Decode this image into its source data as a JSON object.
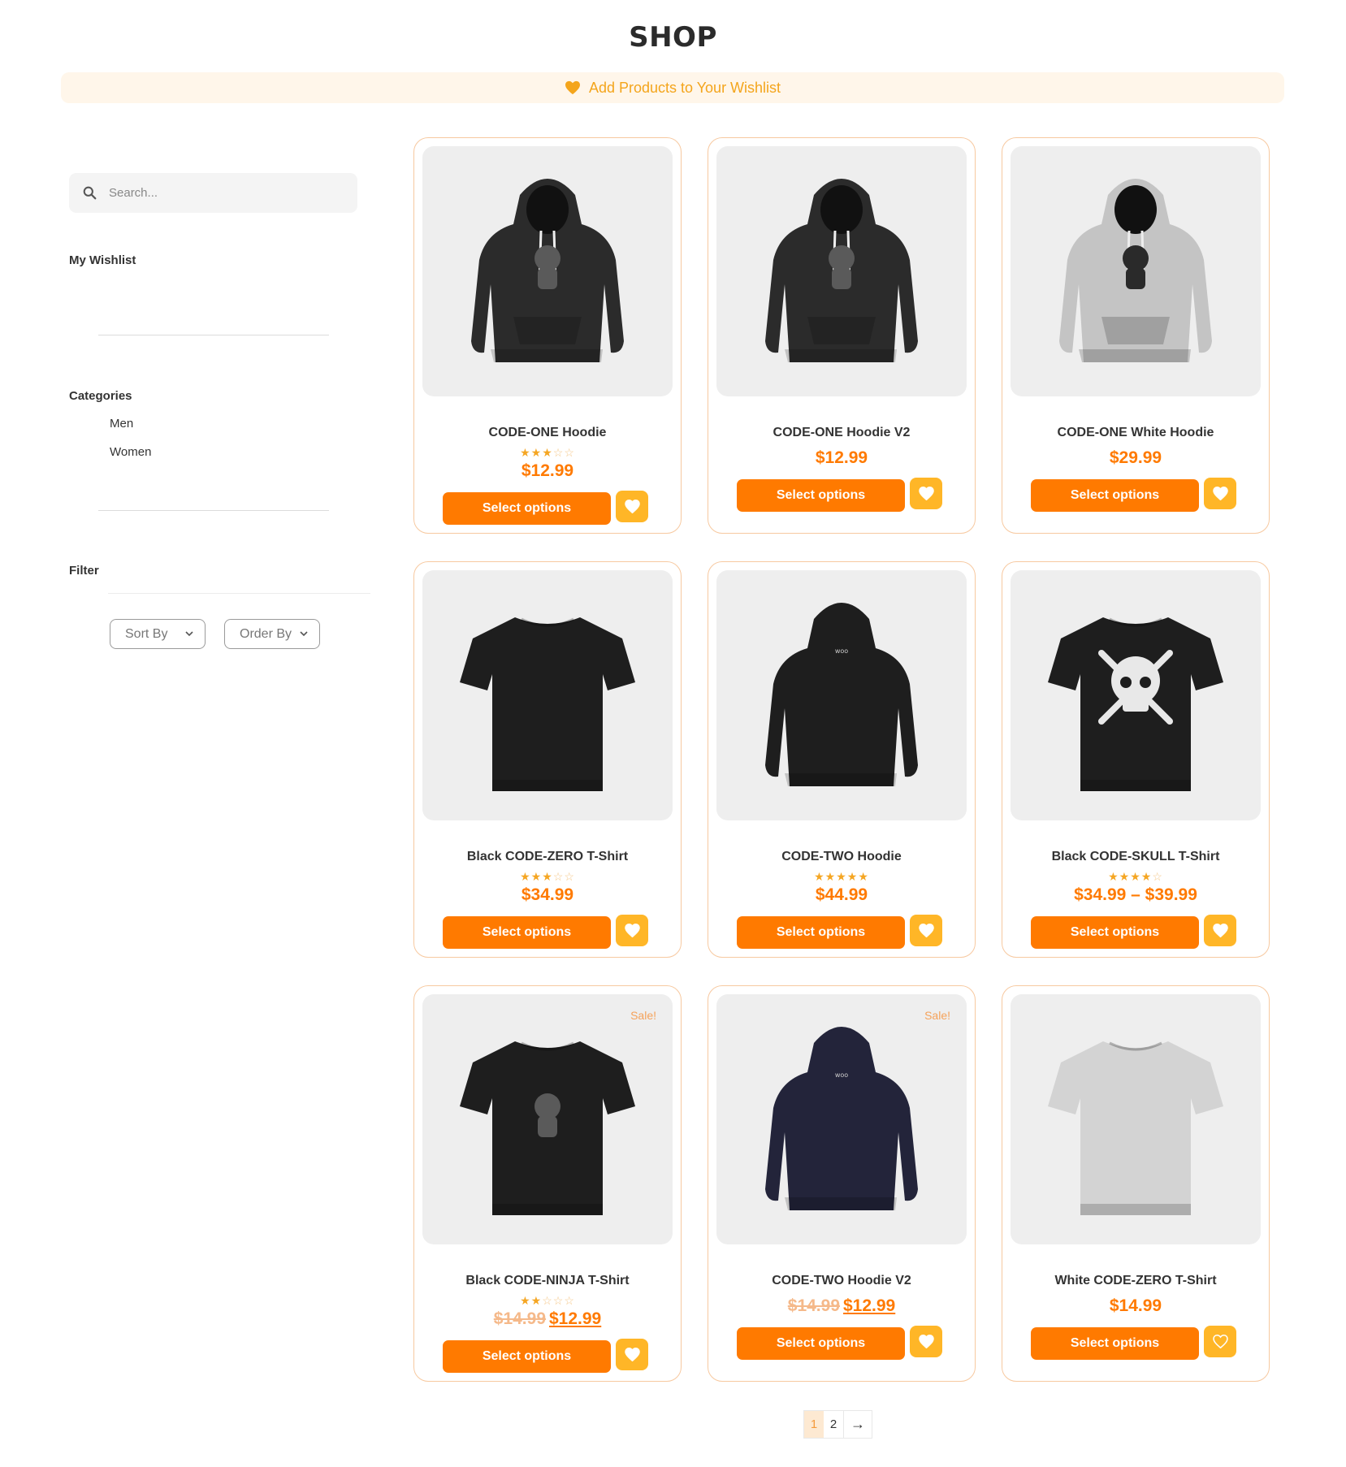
{
  "page": {
    "title": "SHOP"
  },
  "banner": {
    "text": "Add Products to Your Wishlist",
    "color": "#f4a51c"
  },
  "sidebar": {
    "search_placeholder": "Search...",
    "wishlist_heading": "My Wishlist",
    "categories_heading": "Categories",
    "categories": [
      "Men",
      "Women"
    ],
    "filter_heading": "Filter",
    "sort_by": "Sort By",
    "order_by": "Order By"
  },
  "products": [
    {
      "name": "CODE-ONE Hoodie",
      "rating": 3,
      "price": "$12.99",
      "old_price": "",
      "sale": false,
      "item": "hoodie",
      "color": "#2b2b2b",
      "graphic": "figure"
    },
    {
      "name": "CODE-ONE Hoodie V2",
      "rating": 0,
      "price": "$12.99",
      "old_price": "",
      "sale": false,
      "item": "hoodie",
      "color": "#2b2b2b",
      "graphic": "figure"
    },
    {
      "name": "CODE-ONE White Hoodie",
      "rating": 0,
      "price": "$29.99",
      "old_price": "",
      "sale": false,
      "item": "hoodie",
      "color": "#c4c4c4",
      "graphic": "figure"
    },
    {
      "name": "Black CODE-ZERO T-Shirt",
      "rating": 3,
      "price": "$34.99",
      "old_price": "",
      "sale": false,
      "item": "tshirt",
      "color": "#1e1e1e",
      "graphic": "none"
    },
    {
      "name": "CODE-TWO Hoodie",
      "rating": 5,
      "price": "$44.99",
      "old_price": "",
      "sale": false,
      "item": "hoodie-back",
      "color": "#1e1e1e",
      "graphic": "none"
    },
    {
      "name": "Black CODE-SKULL T-Shirt",
      "rating": 4,
      "price": "$34.99 – $39.99",
      "old_price": "",
      "sale": false,
      "item": "tshirt",
      "color": "#1e1e1e",
      "graphic": "skull"
    },
    {
      "name": "Black CODE-NINJA T-Shirt",
      "rating": 2,
      "price": "$12.99",
      "old_price": "$14.99",
      "sale": true,
      "item": "tshirt",
      "color": "#1e1e1e",
      "graphic": "figure"
    },
    {
      "name": "CODE-TWO Hoodie V2",
      "rating": 0,
      "price": "$12.99",
      "old_price": "$14.99",
      "sale": true,
      "item": "hoodie-back",
      "color": "#23243a",
      "graphic": "none"
    },
    {
      "name": "White CODE-ZERO T-Shirt",
      "rating": 0,
      "price": "$14.99",
      "old_price": "",
      "sale": false,
      "item": "tshirt",
      "color": "#d3d3d3",
      "graphic": "none"
    }
  ],
  "labels": {
    "select_options": "Select options",
    "sale": "Sale!"
  },
  "pagination": {
    "current": "1",
    "pages": [
      "1",
      "2"
    ],
    "next": "→"
  },
  "colors": {
    "accent": "#ff7a00",
    "heart_button": "#ffb627",
    "card_border": "#f7c9a0"
  }
}
